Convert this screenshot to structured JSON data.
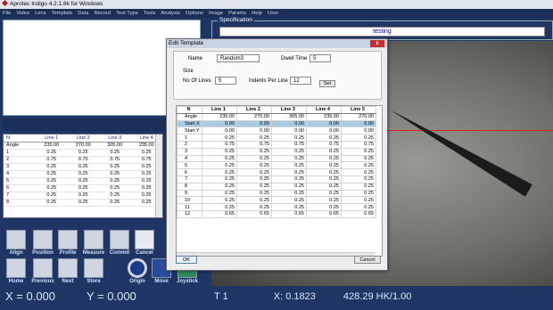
{
  "window": {
    "title": "Aprotec Indigo  4.2.1.8k for Windows"
  },
  "menu": [
    "File",
    "Video",
    "Lens",
    "Template",
    "Data",
    "Record",
    "Test Type",
    "Tools",
    "Analysis",
    "Options",
    "Image",
    "Params",
    "Help",
    "User"
  ],
  "left_table": {
    "headers": [
      "N",
      "Line 1",
      "Line 2",
      "Line 3",
      "Line 4"
    ],
    "rows": [
      [
        "Angle",
        "235.00",
        "270.00",
        "305.00",
        "235.00"
      ],
      [
        "1",
        "0.25",
        "0.25",
        "0.25",
        "0.25"
      ],
      [
        "2",
        "0.75",
        "0.75",
        "0.75",
        "0.75"
      ],
      [
        "3",
        "0.25",
        "0.25",
        "0.25",
        "0.25"
      ],
      [
        "4",
        "0.25",
        "0.25",
        "0.25",
        "0.25"
      ],
      [
        "5",
        "0.25",
        "0.25",
        "0.25",
        "0.25"
      ],
      [
        "6",
        "0.25",
        "0.25",
        "0.25",
        "0.25"
      ],
      [
        "7",
        "0.25",
        "0.25",
        "0.25",
        "0.25"
      ],
      [
        "8",
        "0.25",
        "0.25",
        "0.25",
        "0.25"
      ]
    ]
  },
  "toolbar": {
    "align": "Align",
    "position": "Position",
    "profile": "Profile",
    "measure": "Measure",
    "commit": "Commit",
    "cancel": "Cancel",
    "home": "Home",
    "previous": "Previous",
    "next": "Next",
    "store": "Store",
    "origin": "Origin",
    "move": "Move",
    "joystick": "Joystick"
  },
  "readout": {
    "x": "X = 0.000",
    "y": "Y = 0.000"
  },
  "status_right": {
    "t": "T 1",
    "x": "X: 0.1823",
    "hk": "428.29  HK/1.00"
  },
  "specification": {
    "legend": "Specification",
    "value": "testing"
  },
  "dialog": {
    "title": "Edit Template",
    "close": "x",
    "name_label": "Name",
    "name_value": "Random3",
    "dwell_label": "Dwell Time",
    "dwell_value": "5",
    "size_label": "Size",
    "lines_label": "No Of Lines",
    "lines_value": "5",
    "indents_label": "Indents Per Line",
    "indents_value": "12",
    "set_label": "Set",
    "ok_label": "OK",
    "cancel_label": "Cancel",
    "grid": {
      "headers": [
        "N",
        "Line 1",
        "Line 2",
        "Line 3",
        "Line 4",
        "Line 5"
      ],
      "rows": [
        [
          "Angle",
          "235.00",
          "270.00",
          "305.00",
          "235.00",
          "270.00"
        ],
        [
          "Start X",
          "0.00",
          "0.00",
          "0.00",
          "0.00",
          "0.00"
        ],
        [
          "Start Y",
          "0.00",
          "0.00",
          "0.00",
          "0.00",
          "0.00"
        ],
        [
          "1",
          "0.25",
          "0.25",
          "0.25",
          "0.25",
          "0.25"
        ],
        [
          "2",
          "0.75",
          "0.75",
          "0.75",
          "0.75",
          "0.75"
        ],
        [
          "3",
          "0.25",
          "0.25",
          "0.25",
          "0.25",
          "0.25"
        ],
        [
          "4",
          "0.25",
          "0.25",
          "0.25",
          "0.25",
          "0.25"
        ],
        [
          "5",
          "0.25",
          "0.25",
          "0.25",
          "0.25",
          "0.25"
        ],
        [
          "6",
          "0.25",
          "0.25",
          "0.25",
          "0.25",
          "0.25"
        ],
        [
          "7",
          "0.25",
          "0.25",
          "0.25",
          "0.25",
          "0.25"
        ],
        [
          "8",
          "0.25",
          "0.25",
          "0.25",
          "0.25",
          "0.25"
        ],
        [
          "9",
          "0.25",
          "0.25",
          "0.25",
          "0.25",
          "0.25"
        ],
        [
          "10",
          "0.25",
          "0.25",
          "0.25",
          "0.25",
          "0.25"
        ],
        [
          "11",
          "0.25",
          "0.25",
          "0.25",
          "0.25",
          "0.25"
        ],
        [
          "12",
          "0.65",
          "0.65",
          "0.65",
          "0.65",
          "0.65"
        ]
      ],
      "selected_row": 1
    }
  },
  "colors": {
    "background": "#1f3664",
    "selected_row": "#a7cbe0",
    "crosshair": "#e02020"
  }
}
